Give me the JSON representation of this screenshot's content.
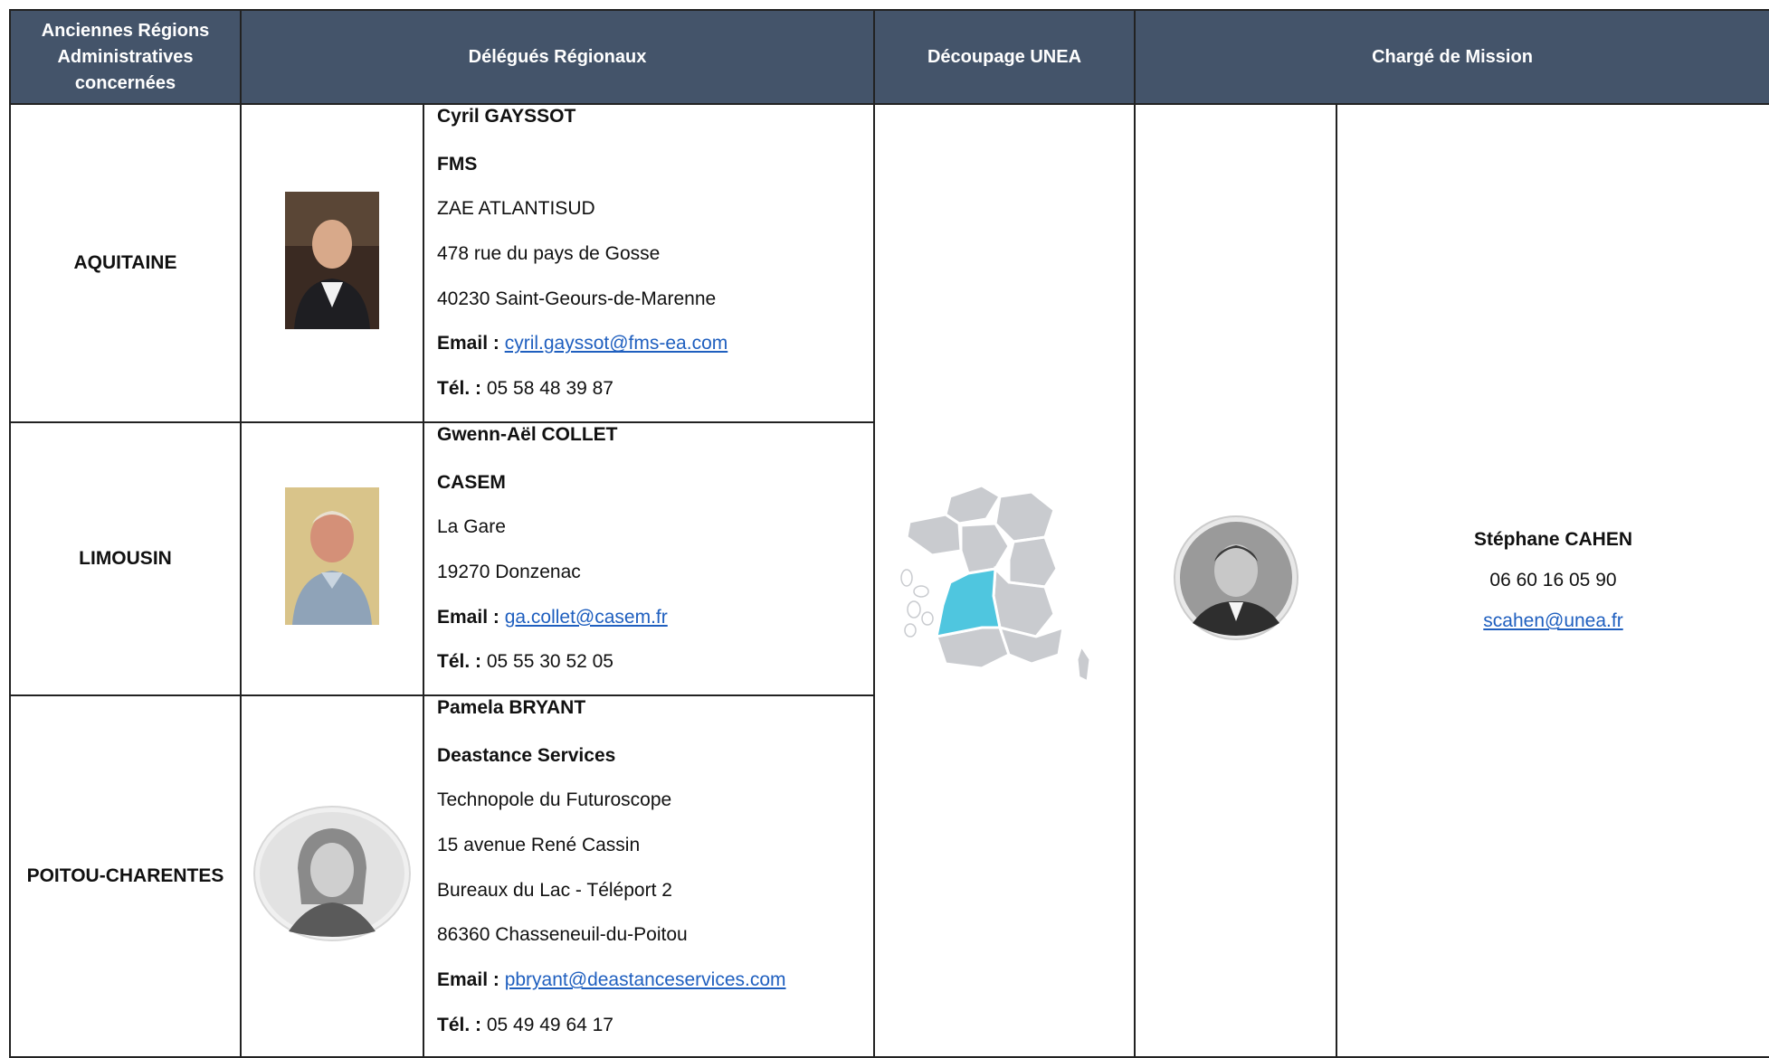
{
  "headers": {
    "regions": "Anciennes Régions Administratives concernées",
    "delegates": "Délégués Régionaux",
    "decoupage": "Découpage UNEA",
    "mission": "Chargé de Mission"
  },
  "rows": [
    {
      "region": "AQUITAINE",
      "name": "Cyril GAYSSOT",
      "company": "FMS",
      "address": [
        "ZAE ATLANTISUD",
        "478 rue du pays de Gosse",
        "40230 Saint-Geours-de-Marenne"
      ],
      "email_label": "Email :",
      "email": "cyril.gayssot@fms-ea.com",
      "tel_label": "Tél. :",
      "tel": "05 58 48 39 87"
    },
    {
      "region": "LIMOUSIN",
      "name": "Gwenn-Aël COLLET",
      "company": "CASEM",
      "address": [
        "La Gare",
        "19270 Donzenac"
      ],
      "email_label": "Email :",
      "email": "ga.collet@casem.fr",
      "tel_label": "Tél. :",
      "tel": "05 55 30 52 05"
    },
    {
      "region": "POITOU-CHARENTES",
      "name": "Pamela BRYANT",
      "company": "Deastance Services",
      "address": [
        "Technopole du Futuroscope",
        "15 avenue René Cassin",
        "Bureaux du Lac - Téléport 2",
        "86360 Chasseneuil-du-Poitou"
      ],
      "email_label": "Email :",
      "email": "pbryant@deastanceservices.com",
      "tel_label": "Tél. :",
      "tel": "05 49 49 64 17"
    }
  ],
  "mission": {
    "name": "Stéphane CAHEN",
    "phone": "06 60 16 05 90",
    "email": "scahen@unea.fr"
  },
  "colors": {
    "header_bg": "#44546a",
    "map_highlight": "#4fc6df",
    "map_regions": "#c9cbcf",
    "link": "#1f5fbf"
  }
}
